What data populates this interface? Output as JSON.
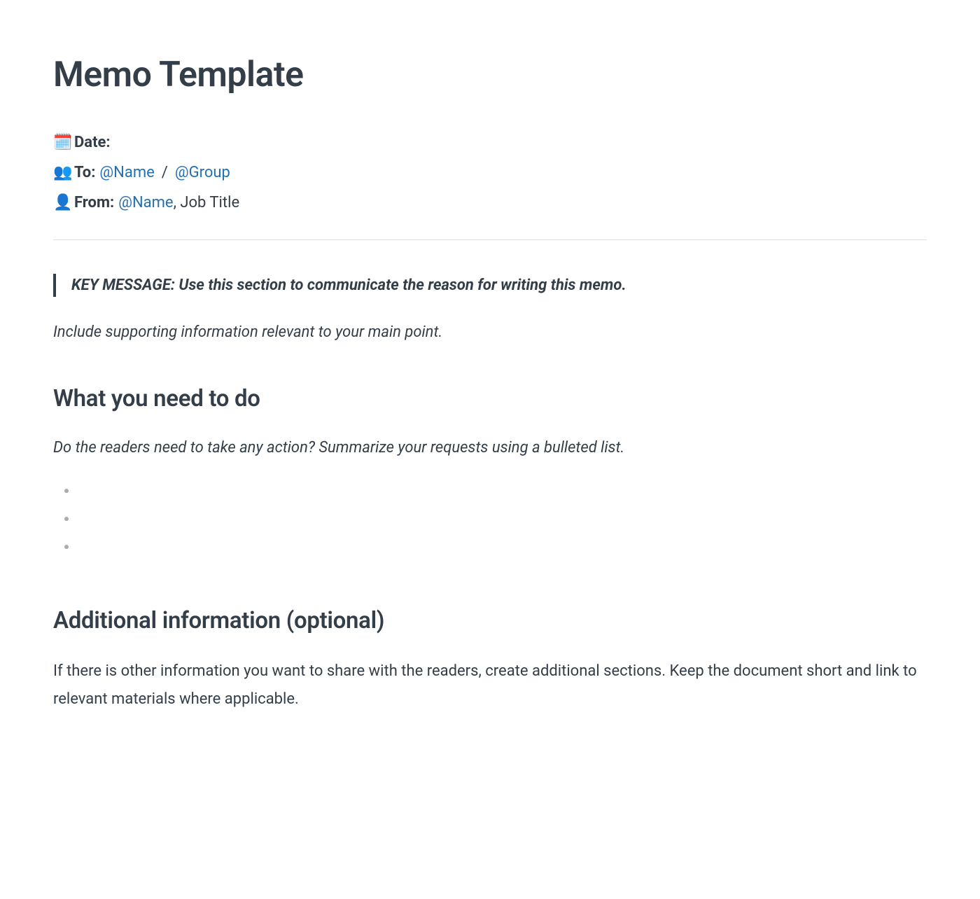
{
  "title": "Memo Template",
  "meta": {
    "date": {
      "icon": "🗓️",
      "label": "Date:"
    },
    "to": {
      "icon": "👥",
      "label": "To:",
      "mention1": "@Name",
      "separator": "/",
      "mention2": "@Group"
    },
    "from": {
      "icon": "👤",
      "label": "From:",
      "mention": "@Name",
      "suffix": ", Job Title"
    }
  },
  "keyMessage": "KEY MESSAGE: Use this section to communicate the reason for writing this memo.",
  "supporting": "Include supporting information relevant to your main point.",
  "section1": {
    "heading": "What you need to do",
    "prompt": "Do the readers need to take any action? Summarize your requests using a bulleted list."
  },
  "section2": {
    "heading": "Additional information (optional)",
    "text": "If there is other information you want to share with the readers, create additional sections. Keep the document short and link to relevant materials where applicable."
  }
}
